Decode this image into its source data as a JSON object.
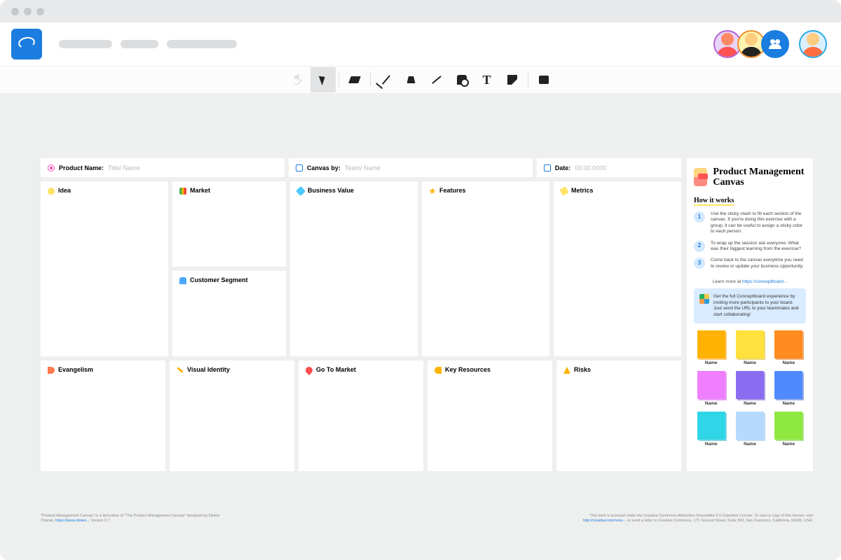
{
  "toolbar": {
    "tools": [
      "hand",
      "select",
      "eraser",
      "pen",
      "marker",
      "line",
      "shape",
      "text",
      "note",
      "comment"
    ],
    "active": "select"
  },
  "header_cells": {
    "product_name": {
      "label": "Product Name:",
      "placeholder": "Title/ Name"
    },
    "canvas_by": {
      "label": "Canvas by:",
      "placeholder": "Team/ Name"
    },
    "date": {
      "label": "Date:",
      "placeholder": "00.00.0000"
    }
  },
  "cells": {
    "idea": "Idea",
    "market": "Market",
    "customer_segment": "Customer Segment",
    "business_value": "Business Value",
    "features": "Features",
    "metrics": "Metrics",
    "evangelism": "Evangelism",
    "visual_identity": "Visual Identity",
    "go_to_market": "Go To Market",
    "key_resources": "Key Resources",
    "risks": "Risks"
  },
  "sidebar": {
    "title": "Product Management Canvas",
    "how_it_works": "How it works",
    "steps": [
      "Use the sticky stash to fill each section of the canvas. If you're doing this exercise with a group, it can be useful to assign a sticky color to each person.",
      "To wrap up the session ask everyone: What was their biggest learning from the exercise?",
      "Come back to the canvas everytime you need to review or update your business opportunity."
    ],
    "learn_more_pre": "Learn more at ",
    "learn_more_link": "https://conceptboard...",
    "promo": "Get the full Conceptboard experience by inviting more participants to your board. Just send the URL to your teammates and start collaborating!",
    "sticky_label": "Name"
  },
  "footer": {
    "left_a": "\"Product Management Canvas\" is a derivative of \"The Product Management Canvas\" designed by Dinker Charak, ",
    "left_link": "https://www.dinker...",
    "left_b": " Version 0.7",
    "right_a": "This work is licensed under the Creative Commons Attribution-ShareAlike 3.0 Unported License. To view a copy of this license, visit ",
    "right_link": "http://creativecommons...",
    "right_b": " or send a letter to Creative Commons, 171 Second Street, Suite 300, San Francisco, California, 94105, USA."
  },
  "stickies": [
    "s1",
    "s2",
    "s3",
    "s4",
    "s5",
    "s6",
    "s7",
    "s8",
    "s9"
  ]
}
